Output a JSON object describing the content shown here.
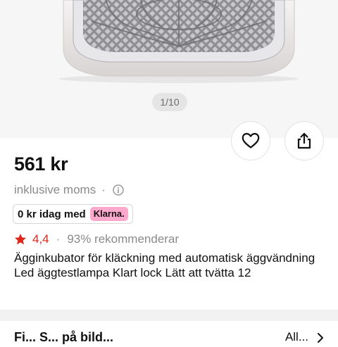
{
  "gallery": {
    "page_indicator": "1/10"
  },
  "actions": {
    "favorite_icon": "heart-icon",
    "share_icon": "share-icon"
  },
  "product": {
    "price": "561 kr",
    "tax_note": "inklusive moms",
    "tax_separator": "·",
    "klarna_text": "0 kr idag med",
    "klarna_badge": "Klarna.",
    "rating_score": "4,4",
    "rating_separator": "·",
    "recommend_text": "93% rekommenderar",
    "title": "Ägginkubator för kläckning med automatisk äggvändning Led äggtestlampa Klart lock Lätt att tvätta 12"
  },
  "section": {
    "title": "Fi... S... på bild...",
    "see_all": "All..."
  },
  "colors": {
    "accent_red": "#e0261b",
    "klarna_pink": "#ffa8cd",
    "muted_text": "#8a8a8a"
  }
}
